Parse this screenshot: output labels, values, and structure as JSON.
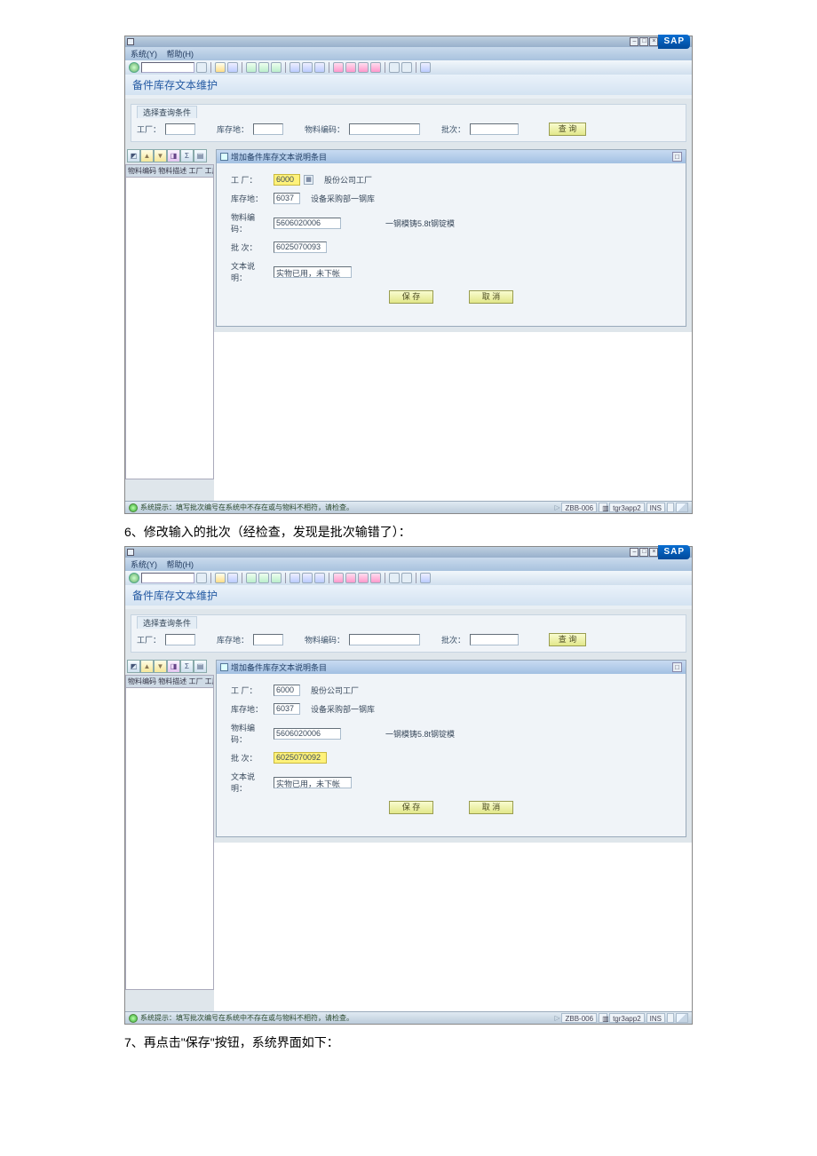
{
  "captions": {
    "step6": "6、修改输入的批次（经检查，发现是批次输错了）：",
    "step7": "7、再点击\"保存\"按钮，系统界面如下："
  },
  "common": {
    "menu_system": "系统(Y)",
    "menu_help": "帮助(H)",
    "sap_logo": "SAP",
    "app_title": "备件库存文本维护",
    "filter_tab": "选择查询条件",
    "lbl_plant": "工厂：",
    "lbl_storage": "库存地：",
    "lbl_material": "物料编码：",
    "lbl_batch": "批次：",
    "btn_query": "查 询",
    "grid_header": "物料编码 物料描述 工厂 工厂名称",
    "dialog_title": "增加备件库存文本说明条目",
    "dlg_lbl_plant": "工 厂：",
    "dlg_lbl_storage": "库存地：",
    "dlg_lbl_material": "物料编码：",
    "dlg_lbl_batch": "批 次：",
    "dlg_lbl_text": "文本说明：",
    "dlg_plant_desc": "股份公司工厂",
    "dlg_storage_val": "6037",
    "dlg_storage_desc": "设备采购部一钢库",
    "dlg_material_val": "5606020006",
    "dlg_material_desc": "一钢模铸5.8t钢锭模",
    "dlg_text_val": "实物已用，未下帐",
    "btn_save": "保 存",
    "btn_cancel": "取 消",
    "status_msg": "系统提示：填写批次编号在系统中不存在或与物料不相符，请检查。",
    "status_client": "ZBB-006",
    "status_srv": "tgr3app2",
    "status_mode": "INS"
  },
  "screen1": {
    "plant_highlight": true,
    "plant_val": "6000",
    "plant_has_f4": true,
    "batch_val": "6025070093",
    "batch_highlight": false
  },
  "screen2": {
    "plant_highlight": false,
    "plant_val": "6000",
    "plant_has_f4": false,
    "batch_val": "6025070092",
    "batch_highlight": true
  }
}
